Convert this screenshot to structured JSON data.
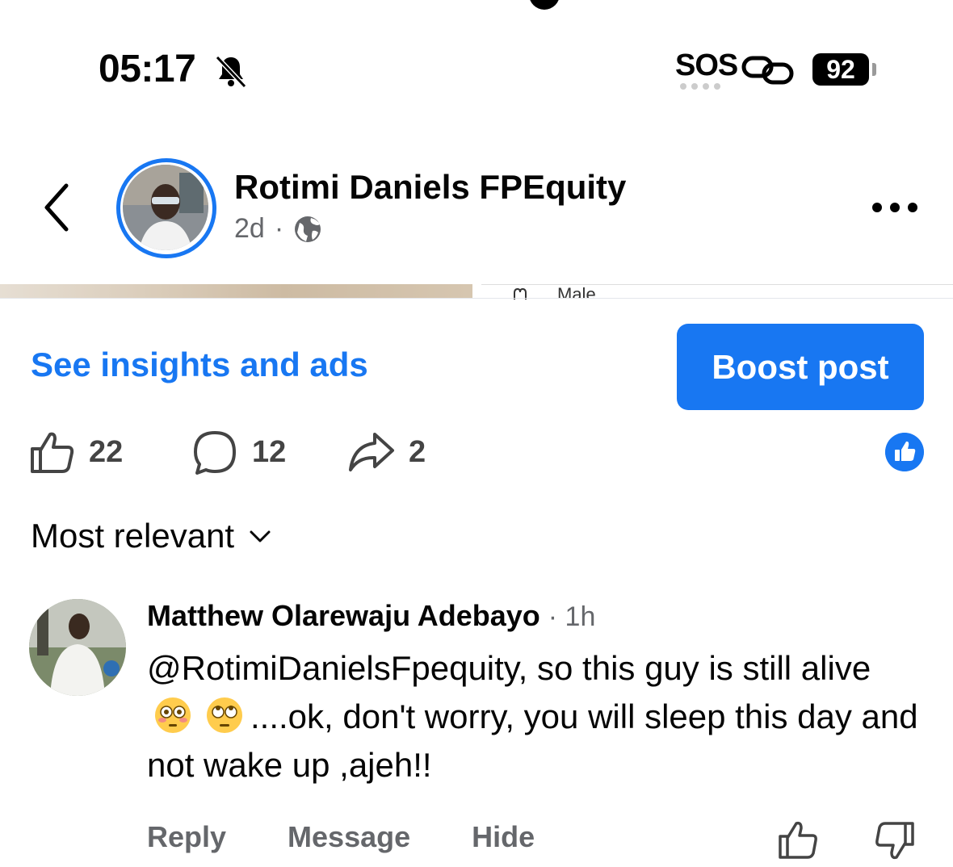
{
  "status_bar": {
    "time": "05:17",
    "sos": "SOS",
    "battery": "92"
  },
  "post": {
    "author": "Rotimi Daniels FPEquity",
    "age": "2d",
    "separator": "·",
    "media_caption": "Male"
  },
  "actions": {
    "insights_label": "See insights and ads",
    "boost_label": "Boost post",
    "like_count": "22",
    "comment_count": "12",
    "share_count": "2"
  },
  "comments": {
    "sort_label": "Most relevant",
    "items": [
      {
        "author": "Matthew Olarewaju Adebayo",
        "time": "· 1h",
        "text_part1": "@RotimiDanielsFpequity, so this guy is still alive",
        "text_part2": "....ok, don't worry, you will sleep this day and not wake up ,ajeh!!",
        "emoji1": "flushed-face",
        "emoji2": "face-with-rolling-eyes",
        "reply_label": "Reply",
        "message_label": "Message",
        "hide_label": "Hide"
      }
    ]
  },
  "colors": {
    "accent": "#1877f2",
    "secondary_text": "#65676b"
  }
}
